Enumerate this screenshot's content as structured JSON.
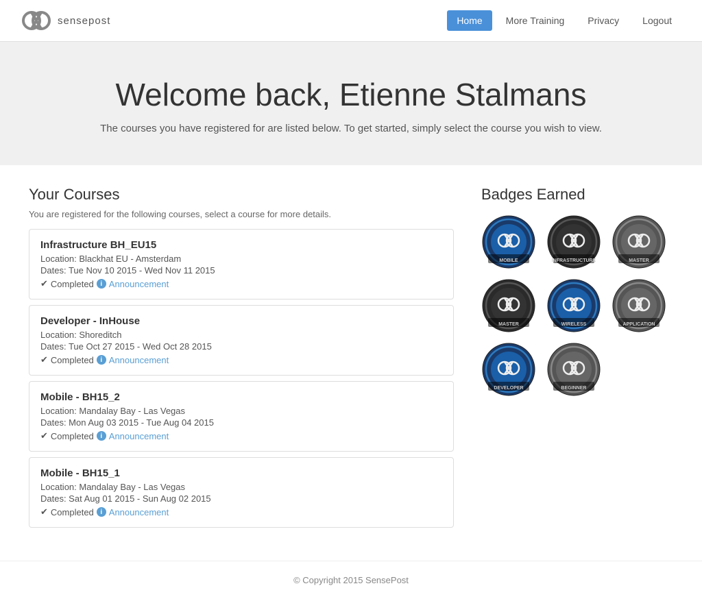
{
  "brand": {
    "name": "sensepost"
  },
  "nav": {
    "links": [
      {
        "label": "Home",
        "active": true
      },
      {
        "label": "More Training",
        "active": false
      },
      {
        "label": "Privacy",
        "active": false
      },
      {
        "label": "Logout",
        "active": false
      }
    ]
  },
  "hero": {
    "heading": "Welcome back, Etienne Stalmans",
    "subtext": "The courses you have registered for are listed below. To get started, simply select the course you wish to view."
  },
  "courses": {
    "heading": "Your Courses",
    "subtitle": "You are registered for the following courses, select a course for more details.",
    "items": [
      {
        "title": "Infrastructure BH_EU15",
        "location": "Location: Blackhat EU - Amsterdam",
        "dates": "Dates: Tue Nov 10 2015 - Wed Nov 11 2015",
        "status": "Completed",
        "announcement": "Announcement"
      },
      {
        "title": "Developer - InHouse",
        "location": "Location: Shoreditch",
        "dates": "Dates: Tue Oct 27 2015 - Wed Oct 28 2015",
        "status": "Completed",
        "announcement": "Announcement"
      },
      {
        "title": "Mobile - BH15_2",
        "location": "Location: Mandalay Bay - Las Vegas",
        "dates": "Dates: Mon Aug 03 2015 - Tue Aug 04 2015",
        "status": "Completed",
        "announcement": "Announcement"
      },
      {
        "title": "Mobile - BH15_1",
        "location": "Location: Mandalay Bay - Las Vegas",
        "dates": "Dates: Sat Aug 01 2015 - Sun Aug 02 2015",
        "status": "Completed",
        "announcement": "Announcement"
      }
    ]
  },
  "badges": {
    "heading": "Badges Earned",
    "items": [
      {
        "label": "MOBILE",
        "type": "mobile",
        "color1": "#1a5fa8",
        "color2": "#2d8fd4"
      },
      {
        "label": "INFRASTRUCTURE",
        "type": "infrastructure",
        "color1": "#1a5fa8",
        "color2": "#555"
      },
      {
        "label": "MASTER",
        "type": "master",
        "color1": "#888",
        "color2": "#aaa"
      },
      {
        "label": "MASTER",
        "type": "master2",
        "color1": "#555",
        "color2": "#777"
      },
      {
        "label": "WIRELESS",
        "type": "wireless",
        "color1": "#1a5fa8",
        "color2": "#2d8fd4"
      },
      {
        "label": "APPLICATION",
        "type": "application",
        "color1": "#888",
        "color2": "#aaa"
      },
      {
        "label": "DEVELOPER",
        "type": "developer",
        "color1": "#1a5fa8",
        "color2": "#2d8fd4"
      },
      {
        "label": "BEGINNER",
        "type": "beginner",
        "color1": "#888",
        "color2": "#aaa"
      }
    ]
  },
  "footer": {
    "text": "© Copyright 2015 SensePost"
  }
}
